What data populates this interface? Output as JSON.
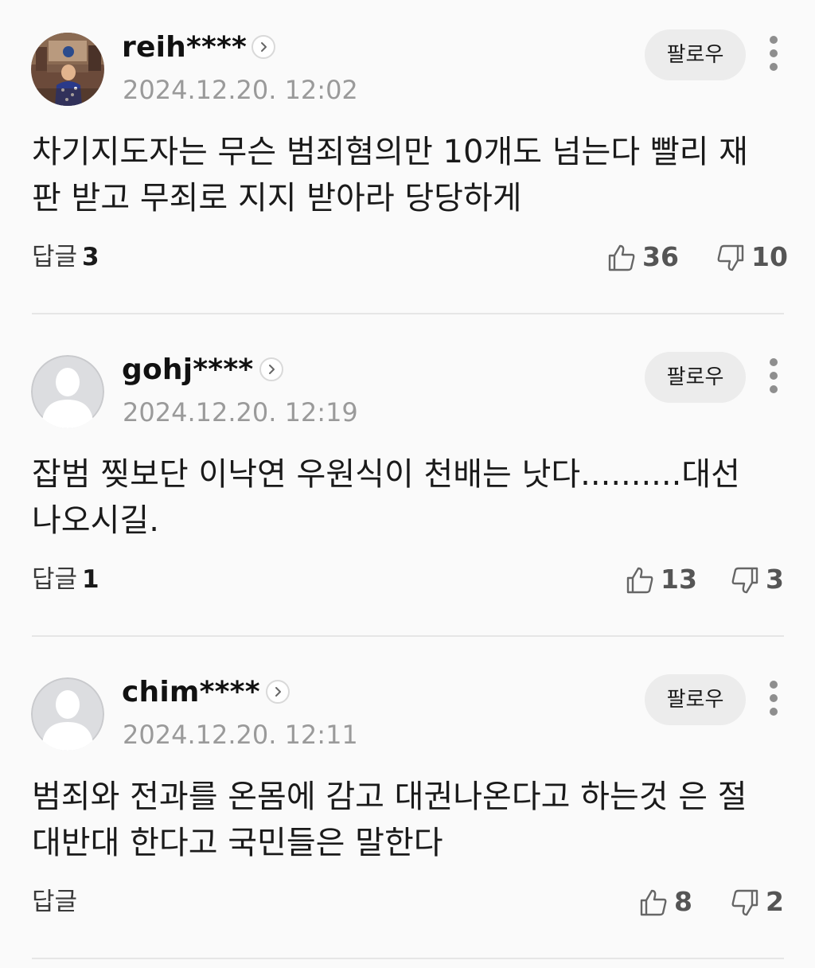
{
  "comments": [
    {
      "username": "reih****",
      "date": "2024.12.20. 12:02",
      "follow_label": "팔로우",
      "text": "차기지도자는 무슨 범죄혐의만 10개도 넘는다 빨리 재판 받고 무죄로 지지 받아라 당당하게",
      "reply_label": "답글",
      "reply_count": "3",
      "likes": "36",
      "dislikes": "10",
      "avatar": "photo-avatar"
    },
    {
      "username": "gohj****",
      "date": "2024.12.20. 12:19",
      "follow_label": "팔로우",
      "text": "잡범 찢보단 이낙연 우원식이 천배는 낫다..........대선 나오시길.",
      "reply_label": "답글",
      "reply_count": "1",
      "likes": "13",
      "dislikes": "3",
      "avatar": "default-avatar"
    },
    {
      "username": "chim****",
      "date": "2024.12.20. 12:11",
      "follow_label": "팔로우",
      "text": "범죄와 전과를 온몸에 감고 대권나온다고 하는것 은 절대반대 한다고 국민들은 말한다",
      "reply_label": "답글",
      "reply_count": "",
      "likes": "8",
      "dislikes": "2",
      "avatar": "default-avatar"
    }
  ],
  "icons": {
    "like": "thumbs-up-outline-icon",
    "dislike": "thumbs-down-outline-icon",
    "more": "vertical-ellipsis-icon",
    "profile": "chevron-right-circle-icon"
  },
  "colors": {
    "background": "#fafafa",
    "follow_button": "#ececec",
    "meta_text": "#9a9a9a",
    "divider": "#e6e6e6"
  }
}
